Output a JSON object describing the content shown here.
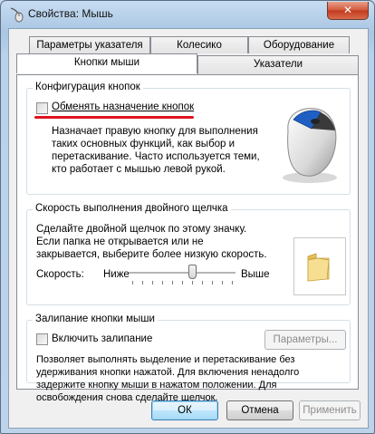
{
  "window": {
    "title": "Свойства: Мышь",
    "close_label": "✕"
  },
  "tabs_row1": [
    {
      "label": "Параметры указателя"
    },
    {
      "label": "Колесико"
    },
    {
      "label": "Оборудование"
    }
  ],
  "tabs_row2": [
    {
      "label": "Кнопки мыши",
      "active": true
    },
    {
      "label": "Указатели"
    }
  ],
  "button_config": {
    "title": "Конфигурация кнопок",
    "swap_label": "Обменять назначение кнопок",
    "swap_checked": false,
    "desc_lines": [
      "Назначает правую кнопку для выполнения",
      "таких основных функций, как выбор и",
      "перетаскивание. Часто используется теми,",
      "кто работает с мышью левой рукой."
    ]
  },
  "double_click": {
    "title": "Скорость выполнения двойного щелчка",
    "desc_lines": [
      "Сделайте двойной щелчок по этому значку.",
      "Если папка не открывается или не",
      "закрывается, выберите более низкую скорость."
    ],
    "speed_label": "Скорость:",
    "slow_label": "Ниже",
    "fast_label": "Выше",
    "speed_value": 0.6
  },
  "click_lock": {
    "title": "Залипание кнопки мыши",
    "enable_label": "Включить залипание",
    "enable_checked": false,
    "settings_button": "Параметры...",
    "desc_lines": [
      "Позволяет выполнять выделение и перетаскивание без",
      "удерживания кнопки нажатой. Для включения ненадолго",
      "задержите кнопку мыши в нажатом положении. Для",
      "освобождения снова сделайте щелчок."
    ]
  },
  "footer": {
    "ok": "ОК",
    "cancel": "Отмена",
    "apply": "Применить"
  },
  "colors": {
    "annotation_underline": "#e0141e",
    "accent_mouse_button": "#1f5fc4"
  }
}
